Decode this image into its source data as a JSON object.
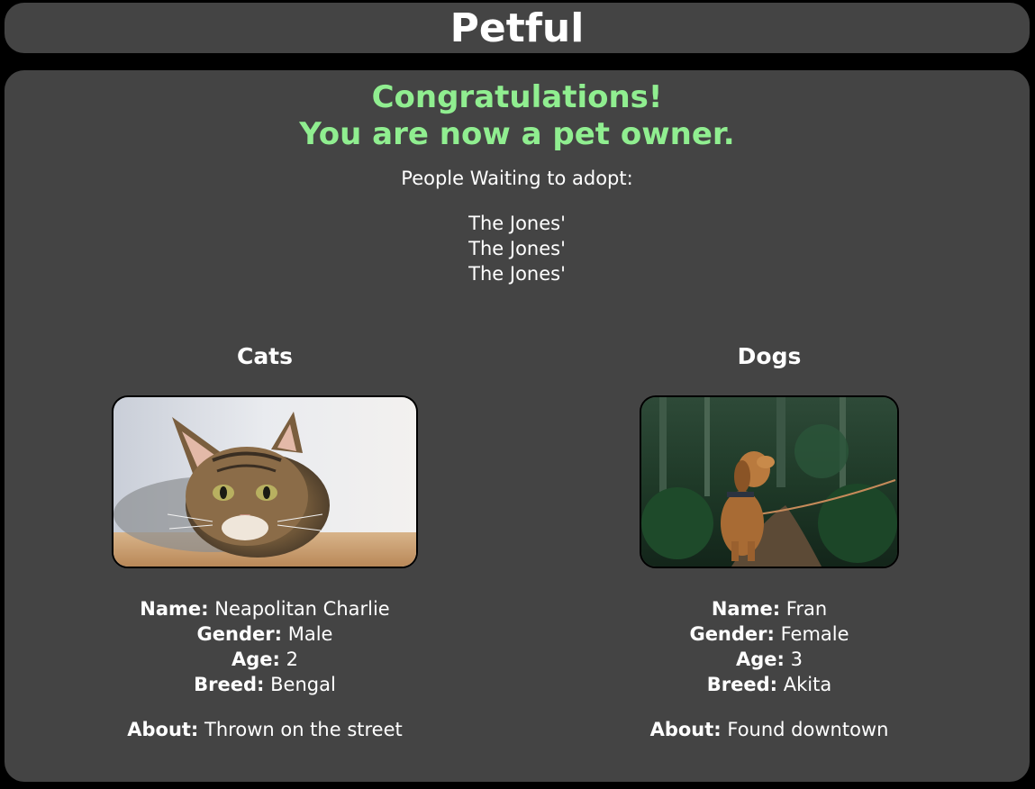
{
  "header": {
    "title": "Petful"
  },
  "congrats": {
    "line1": "Congratulations!",
    "line2": "You are now a pet owner."
  },
  "queue": {
    "label": "People Waiting to adopt:",
    "people": [
      "The Jones'",
      "The Jones'",
      "The Jones'"
    ]
  },
  "cat": {
    "heading": "Cats",
    "name_label": "Name:",
    "name": "Neapolitan Charlie",
    "gender_label": "Gender:",
    "gender": "Male",
    "age_label": "Age:",
    "age": "2",
    "breed_label": "Breed:",
    "breed": "Bengal",
    "about_label": "About:",
    "about": "Thrown on the street"
  },
  "dog": {
    "heading": "Dogs",
    "name_label": "Name:",
    "name": "Fran",
    "gender_label": "Gender:",
    "gender": "Female",
    "age_label": "Age:",
    "age": "3",
    "breed_label": "Breed:",
    "breed": "Akita",
    "about_label": "About:",
    "about": "Found downtown"
  },
  "colors": {
    "background": "#000000",
    "panel": "#444444",
    "accent_green": "#90ee90",
    "text": "#ffffff"
  }
}
